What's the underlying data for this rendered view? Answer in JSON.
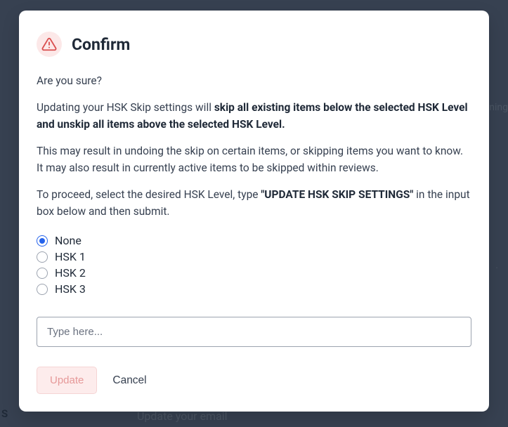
{
  "modal": {
    "title": "Confirm",
    "line1": "Are you sure?",
    "line2_before": "Updating your HSK Skip settings will ",
    "line2_bold": "skip all existing items below the selected HSK Level and unskip all items above the selected HSK Level.",
    "line3": "This may result in undoing the skip on certain items, or skipping items you want to know. It may also result in currently active items to be skipped within reviews.",
    "line4_before": "To proceed, select the desired HSK Level, type ",
    "line4_bold": "\"UPDATE HSK SKIP SETTINGS\"",
    "line4_after": " in the input box below and then submit.",
    "options": {
      "opt0": "None",
      "opt1": "HSK 1",
      "opt2": "HSK 2",
      "opt3": "HSK 3"
    },
    "input_placeholder": "Type here...",
    "update_label": "Update",
    "cancel_label": "Cancel"
  },
  "background": {
    "right_fragment": "ning",
    "dot": ".",
    "bottom_left": "S",
    "bottom_mid": "Update your email"
  }
}
